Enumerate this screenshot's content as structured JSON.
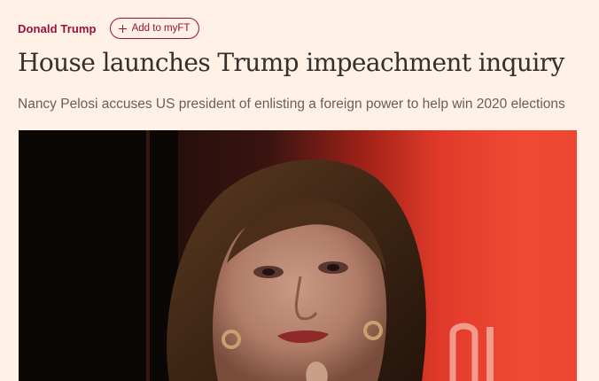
{
  "article": {
    "topic": "Donald Trump",
    "myft_button": "Add to myFT",
    "headline": "House launches Trump impeachment inquiry",
    "standfirst": "Nancy Pelosi accuses US president of enlisting a foreign power to help win 2020 elections"
  },
  "colors": {
    "page_background": "#fff1e5",
    "accent": "#990f3d",
    "headline": "#33302e",
    "standfirst": "#66605c"
  },
  "icons": {
    "myft_button_icon": "plus-icon"
  }
}
